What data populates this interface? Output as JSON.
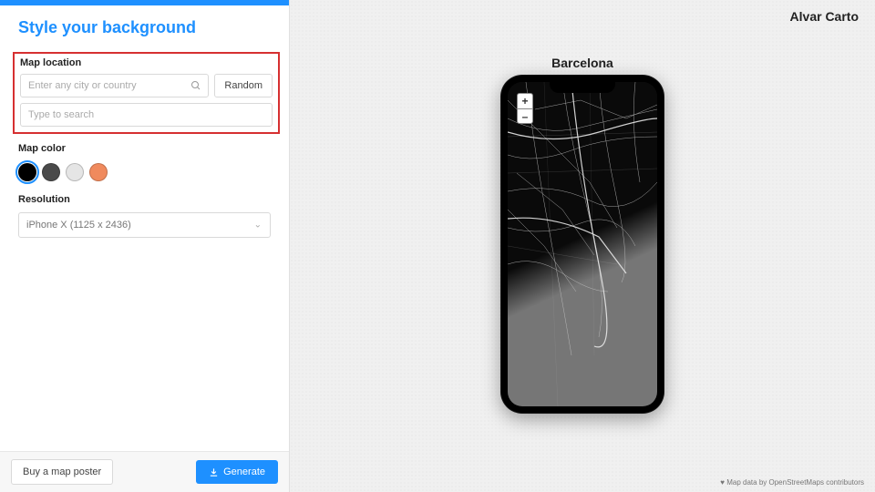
{
  "title": "Style your background",
  "brand": "Alvar Carto",
  "location": {
    "label": "Map location",
    "city_placeholder": "Enter any city or country",
    "search_placeholder": "Type to search",
    "random_label": "Random"
  },
  "color": {
    "label": "Map color",
    "swatches": [
      "#000000",
      "#4a4a4a",
      "#e5e5e5",
      "#f08a5d"
    ],
    "selected": 0
  },
  "resolution": {
    "label": "Resolution",
    "value": "iPhone X (1125 x 2436)"
  },
  "footer": {
    "buy": "Buy a map poster",
    "generate": "Generate"
  },
  "preview": {
    "city": "Barcelona",
    "zoom_in": "+",
    "zoom_out": "–",
    "attribution": "Map data by OpenStreetMaps contributors"
  }
}
